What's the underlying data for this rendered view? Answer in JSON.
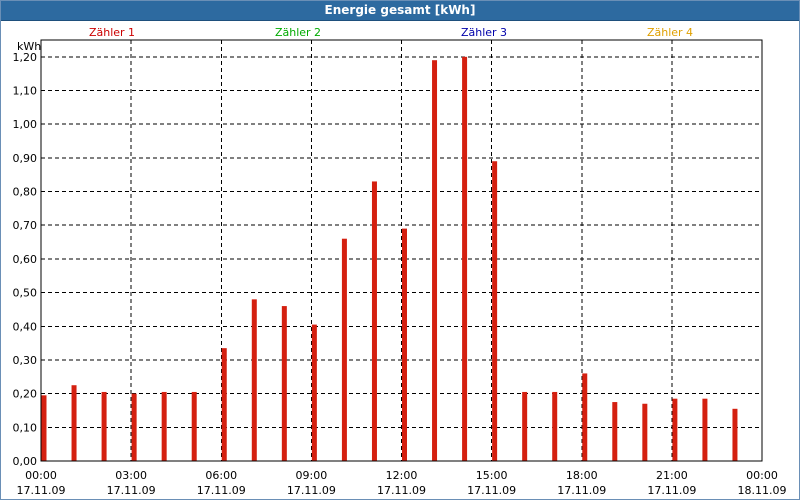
{
  "window": {
    "title": "Energie gesamt [kWh]"
  },
  "meters": [
    {
      "label": "Zähler 1",
      "color": "#cc0000"
    },
    {
      "label": "Zähler 2",
      "color": "#00aa00"
    },
    {
      "label": "Zähler 3",
      "color": "#0000aa"
    },
    {
      "label": "Zähler 4",
      "color": "#e0a000"
    }
  ],
  "chart_data": {
    "type": "bar",
    "title": "Energie gesamt [kWh]",
    "ylabel": "kWh",
    "ylim": [
      0,
      1.25
    ],
    "yticks": [
      "0,00",
      "0,10",
      "0,20",
      "0,30",
      "0,40",
      "0,50",
      "0,60",
      "0,70",
      "0,80",
      "0,90",
      "1,00",
      "1,10",
      "1,20"
    ],
    "ytick_values": [
      0,
      0.1,
      0.2,
      0.3,
      0.4,
      0.5,
      0.6,
      0.7,
      0.8,
      0.9,
      1.0,
      1.1,
      1.2
    ],
    "xlim_hours": [
      0,
      24
    ],
    "xticks": [
      {
        "time": "00:00",
        "date": "17.11.09"
      },
      {
        "time": "03:00",
        "date": "17.11.09"
      },
      {
        "time": "06:00",
        "date": "17.11.09"
      },
      {
        "time": "09:00",
        "date": "17.11.09"
      },
      {
        "time": "12:00",
        "date": "17.11.09"
      },
      {
        "time": "15:00",
        "date": "17.11.09"
      },
      {
        "time": "18:00",
        "date": "17.11.09"
      },
      {
        "time": "21:00",
        "date": "17.11.09"
      },
      {
        "time": "00:00",
        "date": "18.11.09"
      }
    ],
    "grid": true,
    "bar_color": "#d42010",
    "series": [
      {
        "name": "Zähler 1",
        "x": [
          "00:00",
          "01:00",
          "02:00",
          "03:00",
          "04:00",
          "05:00",
          "06:00",
          "07:00",
          "08:00",
          "09:00",
          "10:00",
          "11:00",
          "12:00",
          "13:00",
          "14:00",
          "15:00",
          "16:00",
          "17:00",
          "18:00",
          "19:00",
          "20:00",
          "21:00",
          "22:00",
          "23:00"
        ],
        "values": [
          0.195,
          0.225,
          0.205,
          0.2,
          0.205,
          0.205,
          0.335,
          0.48,
          0.46,
          0.405,
          0.66,
          0.83,
          0.69,
          1.19,
          1.2,
          0.89,
          0.205,
          0.205,
          0.26,
          0.175,
          0.17,
          0.185,
          0.185,
          0.155
        ]
      }
    ]
  }
}
